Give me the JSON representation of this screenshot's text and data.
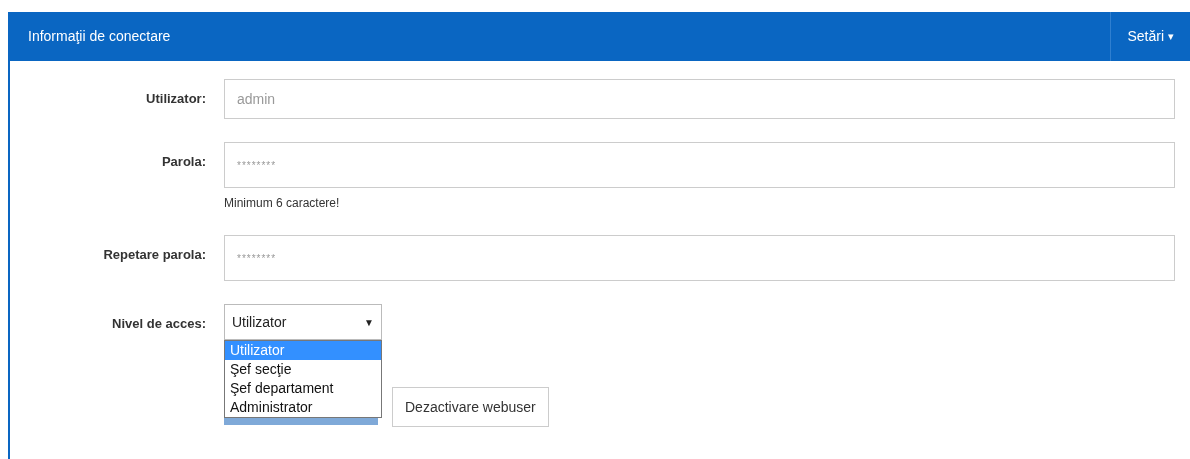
{
  "panel": {
    "title": "Informaţii de conectare",
    "menu": {
      "label": "Setări",
      "icon": "▾"
    }
  },
  "fields": [
    {
      "label": "Utilizator:",
      "kind": "text",
      "placeholder": "admin"
    },
    {
      "label": "Parola:",
      "kind": "password",
      "placeholder": "********",
      "hint": "Minimum 6 caractere!"
    },
    {
      "label": "Repetare parola:",
      "kind": "password",
      "placeholder": "********"
    },
    {
      "label": "Nivel de acces:",
      "kind": "select",
      "value": "Utilizator",
      "arrow": "▼",
      "expanded": true,
      "options": [
        {
          "label": "Utilizator",
          "selected": true
        },
        {
          "label": "Şef secţie",
          "selected": false
        },
        {
          "label": "Şef departament",
          "selected": false
        },
        {
          "label": "Administrator",
          "selected": false
        }
      ]
    }
  ],
  "buttons": [
    {
      "label": "Dezactivare webuser"
    }
  ]
}
